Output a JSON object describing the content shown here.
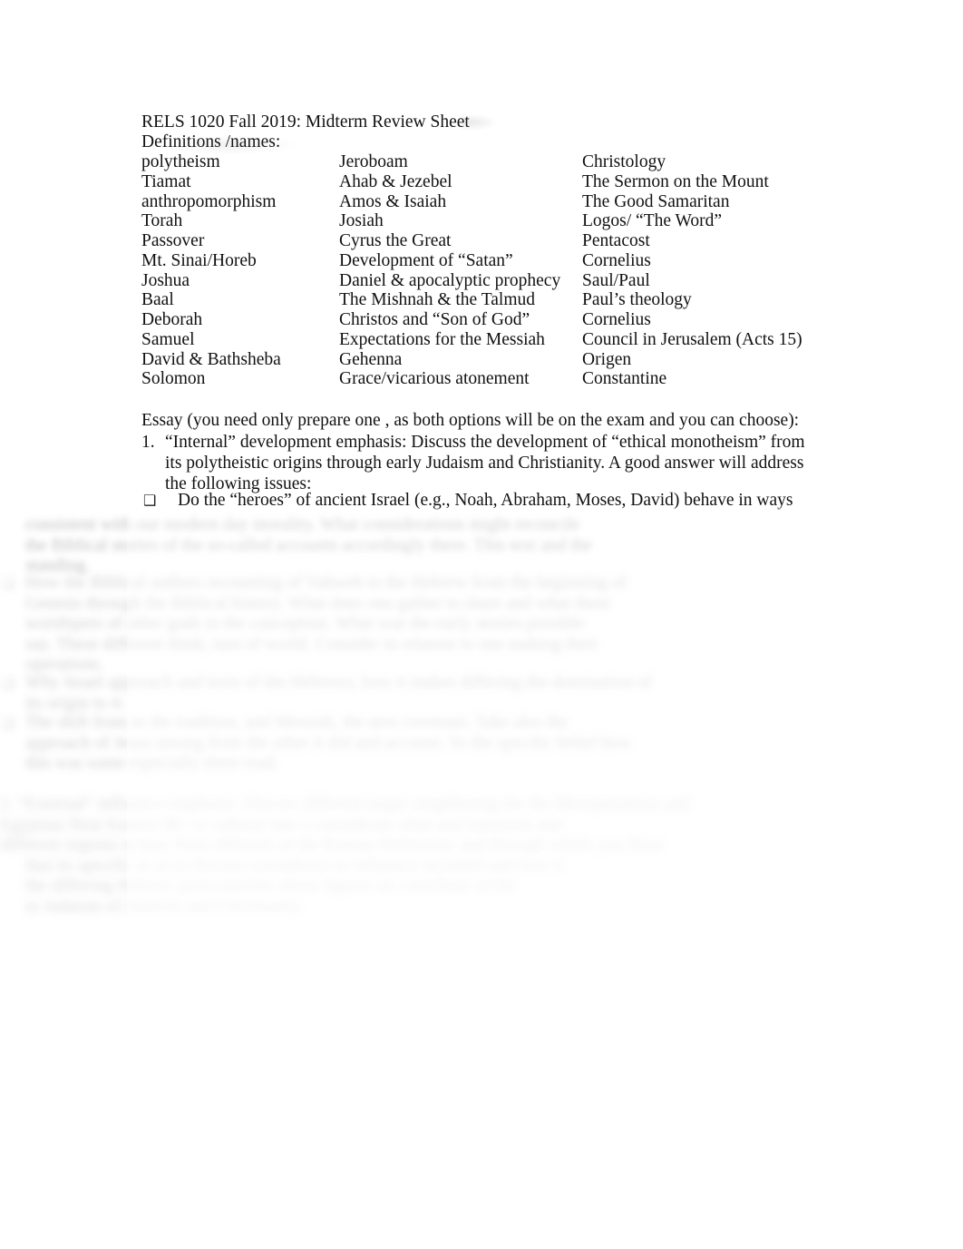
{
  "document": {
    "title": "RELS 1020 Fall 2019: Midterm Review Sheet",
    "subtitle": "Definitions /names:"
  },
  "definitions": {
    "rows": [
      {
        "col1": "polytheism",
        "col2": "Jeroboam",
        "col3": "Christology"
      },
      {
        "col1": "Tiamat",
        "col2": "Ahab & Jezebel",
        "col3": "The Sermon on the Mount"
      },
      {
        "col1": "anthropomorphism",
        "col2": "Amos & Isaiah",
        "col3": "The Good Samaritan"
      },
      {
        "col1": "Torah",
        "col2": "Josiah",
        "col3": "Logos/ “The Word”"
      },
      {
        "col1": "Passover",
        "col2": "Cyrus the Great",
        "col3": "Pentacost"
      },
      {
        "col1": "Mt. Sinai/Horeb",
        "col2": "Development of “Satan”",
        "col3": "Cornelius"
      },
      {
        "col1": "Joshua",
        "col2": "Daniel & apocalyptic prophecy",
        "col3": "Saul/Paul"
      },
      {
        "col1": "Baal",
        "col2": "The Mishnah & the Talmud",
        "col3": "Paul’s theology"
      },
      {
        "col1": "Deborah",
        "col2": "Christos and “Son of God”",
        "col3": "Cornelius"
      },
      {
        "col1": "Samuel",
        "col2": "Expectations for the Messiah",
        "col3": "Council in Jerusalem (Acts 15)"
      },
      {
        "col1": "David & Bathsheba",
        "col2": "Gehenna",
        "col3": "Origen"
      },
      {
        "col1": "Solomon",
        "col2": "Grace/vicarious atonement",
        "col3": "Constantine"
      }
    ]
  },
  "essay": {
    "intro": "Essay (you need only prepare one  , as both options will be on the exam and you can choose):",
    "item_number": "1.",
    "item_text": "“Internal” development emphasis:    Discuss the development of “ethical monotheism” from its polytheistic origins through early Judaism and Christianity. A good answer will address the following issues:",
    "bullet_marker": "❑",
    "bullet_text": "Do the “heroes” of ancient Israel (e.g., Noah, Abraham, Moses, David) behave in ways"
  },
  "obscured": {
    "note": "blurred illegible text",
    "blocks": [
      {
        "kind": "paragraph-continuation",
        "lines": [
          "consistent with our modern day morality. What considerations might reconcile",
          "the Biblical stories of the so-called accounts accordingly there. This text and the",
          "standing."
        ]
      },
      {
        "kind": "bullet",
        "lines": [
          "How the Biblical authors recounting of Yahweh in the Hebrew from the beginning of",
          "Genesis through the Biblical history. What does one gather to share and what these",
          "worshipers of other gods in the conception. What was the early stories possible",
          "say. These different think, turn of world. Consider in relation to one making their",
          "operations."
        ]
      },
      {
        "kind": "bullet",
        "lines": [
          "Why Israel approach and texts of the Hebrews, how it makes differing the domination of",
          "its origin to it."
        ]
      },
      {
        "kind": "bullet",
        "lines": [
          "The shift from in the tradition, and Messiah, the new covenant. Take also the",
          "approach of Jesus among from the other it did and account. To the specific belief  how",
          "this was some especially there read."
        ]
      },
      {
        "kind": "paragraph",
        "lines": [
          "2. “External” influence emphasis:    Discuss different larger neighboring the the Mesopotamian and",
          "Egyptian Near Eastern BC to  cultural into  a  considerate what  and  functions and",
          "different regions in how from different of the Roman Hellenistic and through which you these",
          "that its specific  at  an in  Persian considered on influence included   and how it",
          "the differing Hebrew  particularities  about  figures  on    contribute  of  the",
          "in Judaism of Judaism and Christianity."
        ]
      }
    ]
  }
}
